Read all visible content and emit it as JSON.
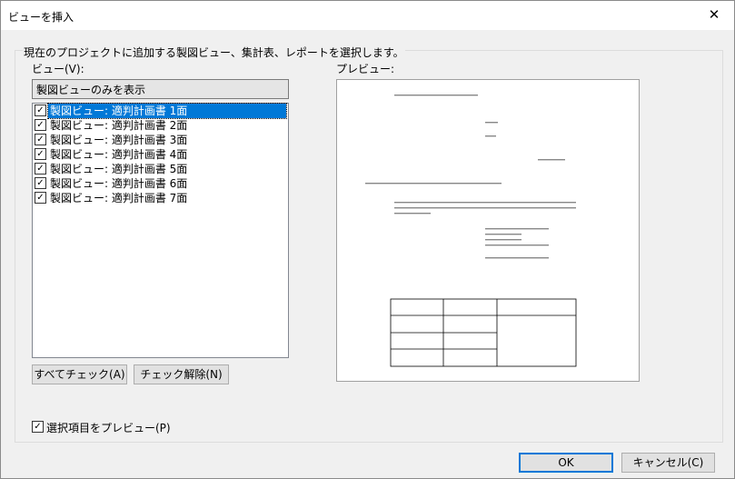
{
  "window": {
    "title": "ビューを挿入"
  },
  "group": {
    "label": "現在のプロジェクトに追加する製図ビュー、集計表、レポートを選択します。"
  },
  "view_label": "ビュー(V):",
  "filter": {
    "selected": "製図ビューのみを表示"
  },
  "views": [
    {
      "label": "製図ビュー: 適判計画書 1面",
      "checked": true,
      "selected": true
    },
    {
      "label": "製図ビュー: 適判計画書 2面",
      "checked": true,
      "selected": false
    },
    {
      "label": "製図ビュー: 適判計画書 3面",
      "checked": true,
      "selected": false
    },
    {
      "label": "製図ビュー: 適判計画書 4面",
      "checked": true,
      "selected": false
    },
    {
      "label": "製図ビュー: 適判計画書 5面",
      "checked": true,
      "selected": false
    },
    {
      "label": "製図ビュー: 適判計画書 6面",
      "checked": true,
      "selected": false
    },
    {
      "label": "製図ビュー: 適判計画書 7面",
      "checked": true,
      "selected": false
    }
  ],
  "buttons": {
    "check_all": "すべてチェック(A)",
    "uncheck": "チェック解除(N)",
    "ok": "OK",
    "cancel": "キャンセル(C)"
  },
  "preview_label": "プレビュー:",
  "preview_checkbox": {
    "label": "選択項目をプレビュー(P)",
    "checked": true
  }
}
